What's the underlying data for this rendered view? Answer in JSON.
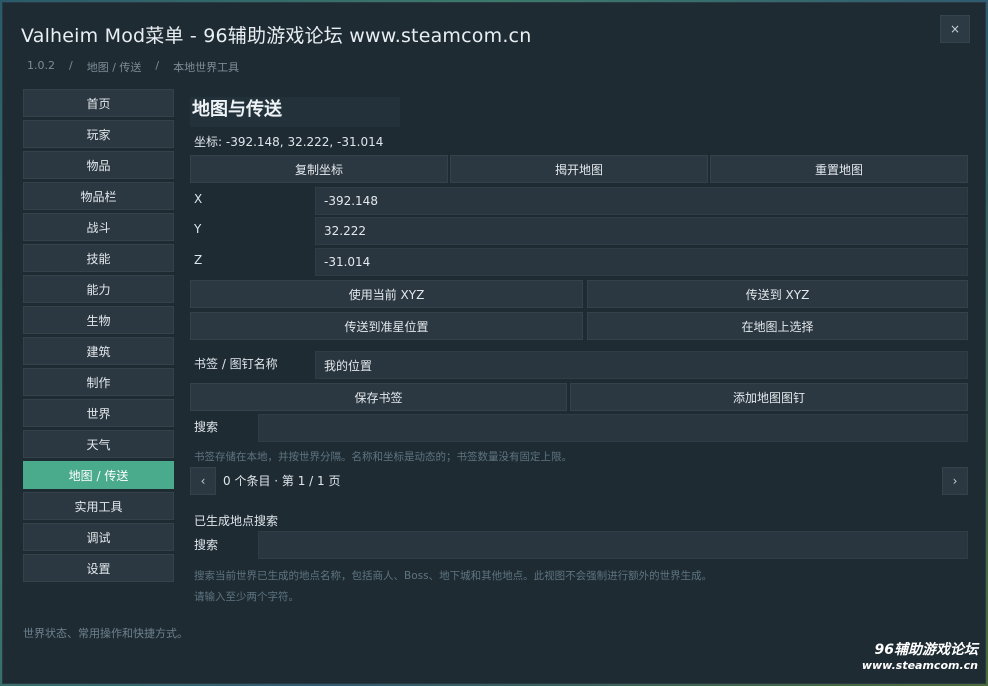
{
  "window": {
    "title": "Valheim Mod菜单 - 96辅助游戏论坛 www.steamcom.cn",
    "close_label": "×"
  },
  "breadcrumb": [
    "1.0.2",
    "地图 / 传送",
    "本地世界工具"
  ],
  "sidebar": {
    "items": [
      {
        "label": "首页"
      },
      {
        "label": "玩家"
      },
      {
        "label": "物品"
      },
      {
        "label": "物品栏"
      },
      {
        "label": "战斗"
      },
      {
        "label": "技能"
      },
      {
        "label": "能力"
      },
      {
        "label": "生物"
      },
      {
        "label": "建筑"
      },
      {
        "label": "制作"
      },
      {
        "label": "世界"
      },
      {
        "label": "天气"
      },
      {
        "label": "地图 / 传送",
        "active": true
      },
      {
        "label": "实用工具"
      },
      {
        "label": "调试"
      },
      {
        "label": "设置"
      }
    ],
    "footer": "世界状态、常用操作和快捷方式。"
  },
  "main": {
    "heading": "地图与传送",
    "coords_text": "坐标: -392.148, 32.222, -31.014",
    "buttons_row1": [
      "复制坐标",
      "揭开地图",
      "重置地图"
    ],
    "x_label": "X",
    "x_value": "-392.148",
    "y_label": "Y",
    "y_value": "32.222",
    "z_label": "Z",
    "z_value": "-31.014",
    "use_current_xyz": "使用当前 XYZ",
    "teleport_xyz": "传送到 XYZ",
    "teleport_crosshair": "传送到准星位置",
    "select_on_map": "在地图上选择",
    "bookmark_label": "书签 / 图钉名称",
    "bookmark_value": "我的位置",
    "save_bookmark": "保存书签",
    "add_map_pin": "添加地图图钉",
    "search_label": "搜索",
    "search_value": "",
    "bookmark_hint": "书签存储在本地，并按世界分隔。名称和坐标是动态的；书签数量没有固定上限。",
    "pager_prev": "‹",
    "pager_text": "0 个条目 · 第 1 / 1 页",
    "pager_next": "›",
    "generated_title": "已生成地点搜索",
    "generated_search_label": "搜索",
    "generated_search_value": "",
    "generated_hint": "搜索当前世界已生成的地点名称，包括商人、Boss、地下城和其他地点。此视图不会强制进行额外的世界生成。",
    "generated_hint2": "请输入至少两个字符。"
  },
  "watermark": {
    "line1": "96辅助游戏论坛",
    "line2": "www.steamcom.cn"
  }
}
